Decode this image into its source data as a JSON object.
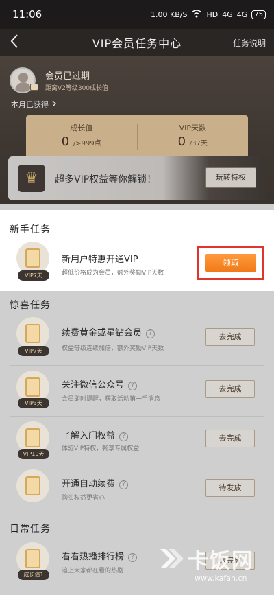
{
  "status_bar": {
    "time": "11:06",
    "net_speed": "1.00 KB/S",
    "hd": "HD",
    "signal1": "4G",
    "signal2": "4G",
    "battery": "75"
  },
  "nav": {
    "title": "VIP会员任务中心",
    "help": "任务说明"
  },
  "profile": {
    "status": "会员已过期",
    "sub": "距离V2等级300成长值",
    "month_gained": "本月已获得"
  },
  "stats": [
    {
      "label": "成长值",
      "value": "0",
      "suffix": "/>999点"
    },
    {
      "label": "VIP天数",
      "value": "0",
      "suffix": "/37天"
    }
  ],
  "vip_banner": {
    "text": "超多VIP权益等你解锁！",
    "button": "玩转特权"
  },
  "sections": {
    "newbie": "新手任务",
    "fun": "惊喜任务",
    "daily": "日常任务"
  },
  "newbie_task": {
    "tag": "VIP7天",
    "title": "新用户特惠开通VIP",
    "desc": "超低价格成为会员，额外奖励VIP天数",
    "button": "领取"
  },
  "fun_tasks": [
    {
      "tag": "VIP7天",
      "title": "续费黄金或星钻会员",
      "desc": "权益等级连续加倍，额外奖励VIP天数",
      "button": "去完成"
    },
    {
      "tag": "VIP3天",
      "title": "关注微信公众号",
      "desc": "会员即时提醒，获取活动第一手消息",
      "button": "去完成"
    },
    {
      "tag": "VIP10天",
      "title": "了解入门权益",
      "desc": "体验VIP特权，畅享专属权益",
      "button": "去完成"
    },
    {
      "tag": "",
      "title": "开通自动续费",
      "desc": "购买权益更省心",
      "button": "待发放"
    }
  ],
  "daily_task": {
    "tag": "成长值1",
    "title": "看看热播排行榜",
    "desc": "追上大家都在看的热剧",
    "button": "去完成"
  },
  "watermark": {
    "text": "卡饭网",
    "url": "www.kafan.cn"
  }
}
